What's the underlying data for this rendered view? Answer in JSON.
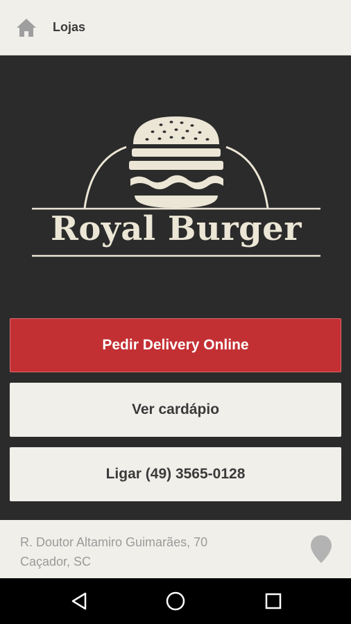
{
  "topbar": {
    "title": "Lojas",
    "icon": "home-icon"
  },
  "brand": {
    "name": "Royal Burger",
    "logo_icon": "burger-icon"
  },
  "actions": {
    "delivery_label": "Pedir Delivery Online",
    "menu_label": "Ver cardápio",
    "call_label": "Ligar (49) 3565-0128"
  },
  "address": {
    "line1": "R. Doutor Altamiro Guimarães, 70",
    "line2": "Caçador, SC",
    "icon": "map-pin-icon"
  },
  "navbar": {
    "back": "back-icon",
    "home": "home-circle-icon",
    "recents": "recents-icon"
  },
  "colors": {
    "background": "#2b2b2b",
    "accent": "#c33034",
    "light_panel": "#f1efea",
    "logo_cream": "#ece6d6"
  }
}
